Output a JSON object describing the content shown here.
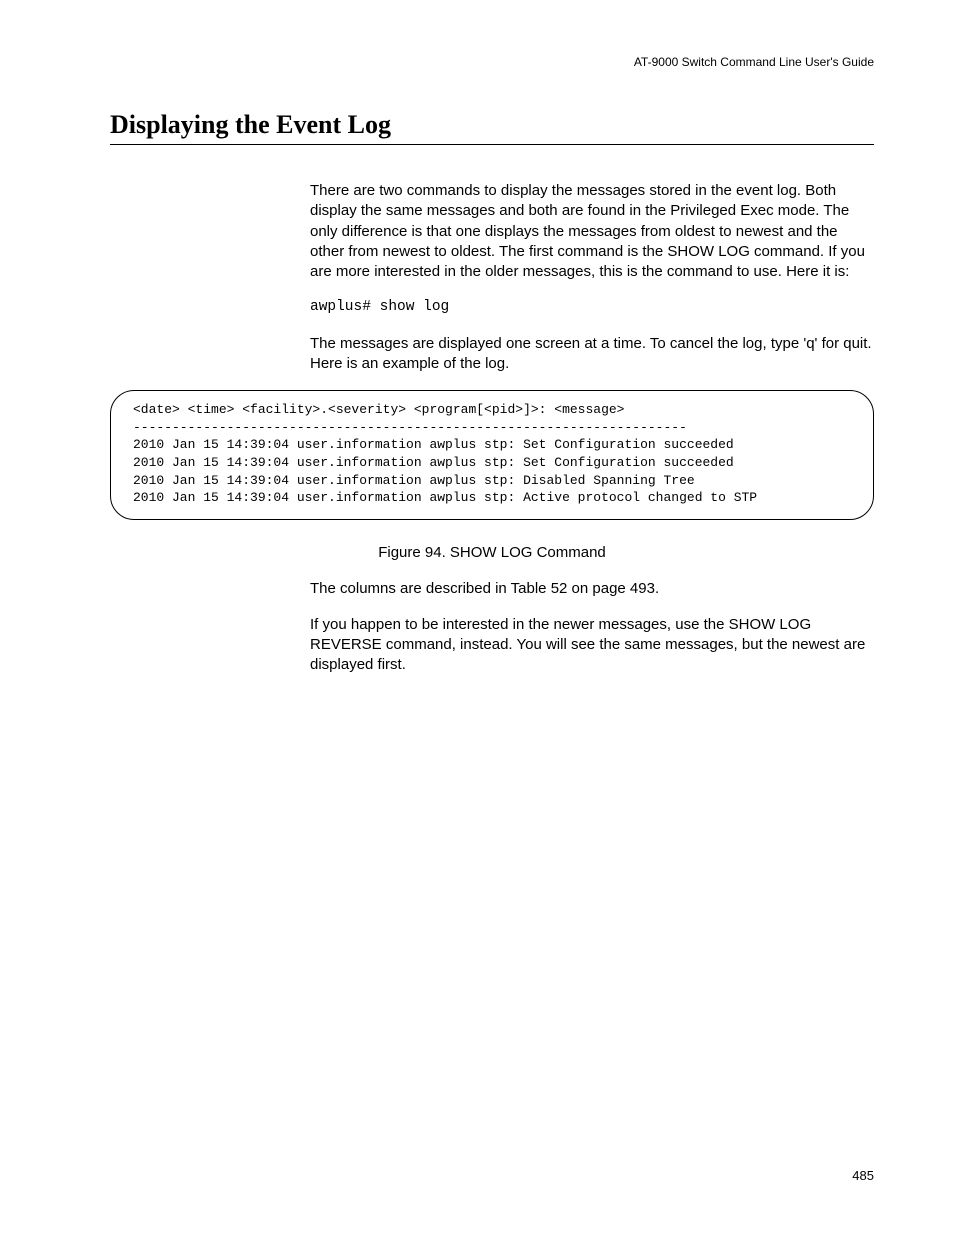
{
  "header": {
    "running_title": "AT-9000 Switch Command Line User's Guide"
  },
  "section": {
    "title": "Displaying the Event Log"
  },
  "body": {
    "para1": "There are two commands to display the messages stored in the event log. Both display the same messages and both are found in the Privileged Exec mode. The only difference is that one displays the messages from oldest to newest and the other from newest to oldest. The first command is the SHOW LOG command. If you are more interested in the older messages, this is the command to use. Here it is:",
    "cmd1": "awplus# show log",
    "para2": "The messages are displayed one screen at a time. To cancel the log, type 'q' for quit. Here is an example of the log.",
    "terminal": "<date> <time> <facility>.<severity> <program[<pid>]>: <message>\n-----------------------------------------------------------------------\n2010 Jan 15 14:39:04 user.information awplus stp: Set Configuration succeeded\n2010 Jan 15 14:39:04 user.information awplus stp: Set Configuration succeeded\n2010 Jan 15 14:39:04 user.information awplus stp: Disabled Spanning Tree\n2010 Jan 15 14:39:04 user.information awplus stp: Active protocol changed to STP",
    "figure_caption": "Figure 94. SHOW LOG Command",
    "para3": "The columns are described in Table 52 on page 493.",
    "para4": "If you happen to be interested in the newer messages, use the SHOW LOG REVERSE command, instead. You will see the same messages, but the newest are displayed first."
  },
  "footer": {
    "page_number": "485"
  }
}
